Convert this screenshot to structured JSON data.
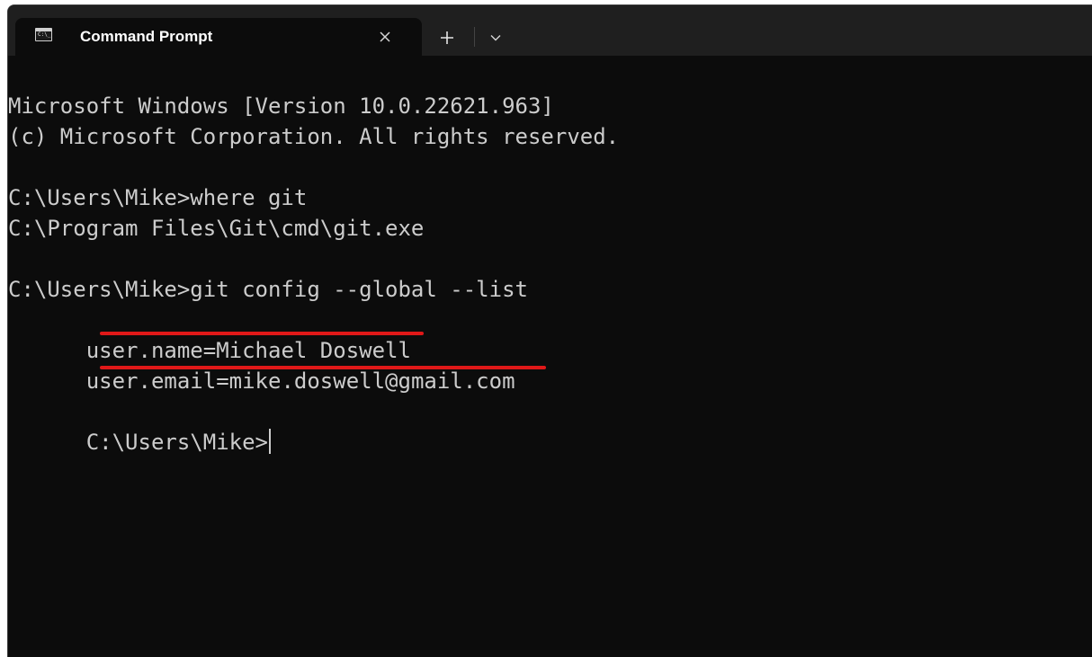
{
  "tab": {
    "title": "Command Prompt",
    "icon": "cmd-icon",
    "icon_text": "C:\\_"
  },
  "tabbar": {
    "close_icon": "close-icon",
    "new_tab_icon": "plus-icon",
    "dropdown_icon": "chevron-down-icon"
  },
  "console": {
    "lines": [
      "Microsoft Windows [Version 10.0.22621.963]",
      "(c) Microsoft Corporation. All rights reserved.",
      "",
      "C:\\Users\\Mike>where git",
      "C:\\Program Files\\Git\\cmd\\git.exe",
      "",
      "C:\\Users\\Mike>git config --global --list"
    ],
    "name_line": {
      "prefix": "user.",
      "highlight": "name=Michael Doswell"
    },
    "email_line": {
      "prefix": "user.",
      "highlight": "email=mike.doswell@gmail.com"
    },
    "prompt": "C:\\Users\\Mike>"
  },
  "colors": {
    "background": "#0c0c0c",
    "tabbar": "#1f1f1f",
    "text": "#cccccc",
    "annotation": "#e01818"
  }
}
